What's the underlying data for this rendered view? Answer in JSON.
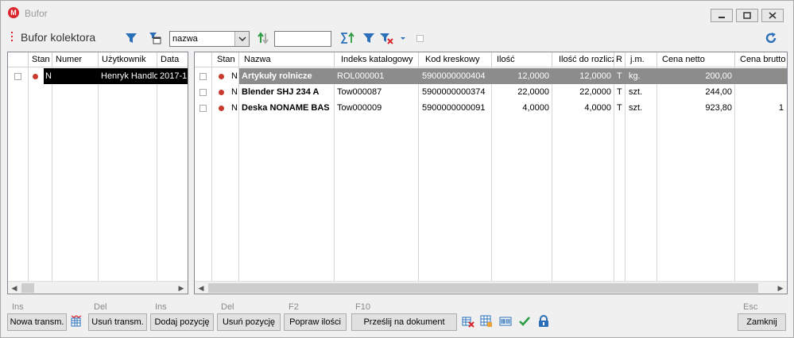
{
  "window": {
    "app_icon_letter": "M",
    "title": "Bufor"
  },
  "toolbar": {
    "title": "Bufor kolektora",
    "sort_field": "nazwa",
    "filter_value": ""
  },
  "left_grid": {
    "headers": [
      "Stan",
      "Numer",
      "Użytkownik",
      "Data"
    ],
    "rows": [
      {
        "stan": "N",
        "numer": "",
        "uzytkownik": "Henryk Handlo",
        "data": "2017-1"
      }
    ]
  },
  "right_grid": {
    "headers": [
      "Stan",
      "Nazwa",
      "Indeks katalogowy",
      "Kod kreskowy",
      "Ilość",
      "Ilość do rozlicz",
      "R",
      "j.m.",
      "Cena netto",
      "Cena brutto"
    ],
    "rows": [
      {
        "stan": "N",
        "nazwa": "Artykuły rolnicze",
        "indeks": "ROL000001",
        "kod": "5900000000404",
        "ilosc": "12,0000",
        "ilosc_rozl": "12,0000",
        "r": "T",
        "jm": "kg.",
        "cena_netto": "200,00",
        "cena_brutto": ""
      },
      {
        "stan": "N",
        "nazwa": "Blender SHJ 234 A",
        "indeks": "Tow000087",
        "kod": "5900000000374",
        "ilosc": "22,0000",
        "ilosc_rozl": "22,0000",
        "r": "T",
        "jm": "szt.",
        "cena_netto": "244,00",
        "cena_brutto": ""
      },
      {
        "stan": "N",
        "nazwa": "Deska NONAME BAS",
        "indeks": "Tow000009",
        "kod": "5900000000091",
        "ilosc": "4,0000",
        "ilosc_rozl": "4,0000",
        "r": "T",
        "jm": "szt.",
        "cena_netto": "923,80",
        "cena_brutto": "1"
      }
    ]
  },
  "bottom": {
    "hints": {
      "ins1": "Ins",
      "del1": "Del",
      "ins2": "Ins",
      "del2": "Del",
      "f2": "F2",
      "f10": "F10",
      "esc": "Esc"
    },
    "buttons": {
      "new_transmission": "Nowa transm.",
      "delete_transmission": "Usuń transm.",
      "add_item": "Dodaj pozycję",
      "delete_item": "Usuń pozycję",
      "fix_quantity": "Popraw ilości",
      "send_to_document": "Prześlij na dokument",
      "close": "Zamknij"
    }
  },
  "colors": {
    "accent_red": "#d9262c",
    "status_dot": "#c83b2c",
    "selected_row": "#8c8c8c",
    "selected_left": "#000000",
    "icon_blue": "#2a6fb8",
    "icon_green": "#2e9e45"
  },
  "icons": [
    "app-logo-icon",
    "filter-icon",
    "calendar-filter-icon",
    "sort-icon",
    "sum-sort-icon",
    "clear-filter-icon",
    "refresh-icon",
    "grid-settings-icon",
    "delete-grid-icon",
    "edit-grid-icon",
    "barcode-icon",
    "check-icon",
    "lock-icon"
  ]
}
